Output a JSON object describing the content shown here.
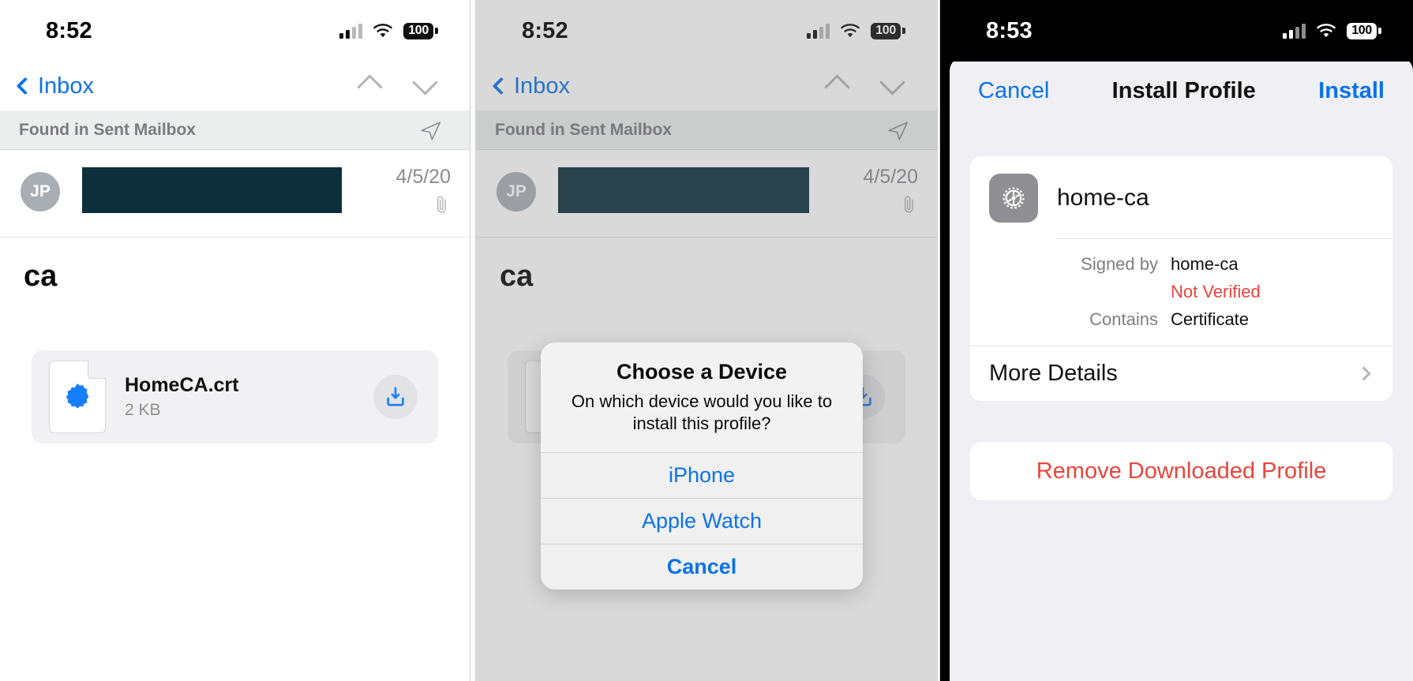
{
  "panels": [
    {
      "id": "mail-attachment",
      "status": {
        "time": "8:52",
        "battery": "100",
        "signal_icon": "cellular-signal-icon",
        "wifi_icon": "wifi-icon",
        "battery_icon": "battery-icon"
      },
      "nav": {
        "back_label": "Inbox",
        "up_icon": "chevron-up-icon",
        "down_icon": "chevron-down-icon",
        "back_icon": "chevron-left-icon"
      },
      "found_banner": {
        "text": "Found in Sent Mailbox",
        "icon": "send-arrow-icon"
      },
      "mail": {
        "avatar_initials": "JP",
        "date": "4/5/20",
        "attachment_icon": "paperclip-icon"
      },
      "subject": "ca",
      "attachment": {
        "filename": "HomeCA.crt",
        "filesize": "2 KB",
        "file_icon": "certificate-badge-icon",
        "download_icon": "download-icon"
      }
    },
    {
      "id": "choose-device",
      "status": {
        "time": "8:52",
        "battery": "100"
      },
      "nav": {
        "back_label": "Inbox"
      },
      "found_banner": {
        "text": "Found in Sent Mailbox"
      },
      "mail": {
        "avatar_initials": "JP",
        "date": "4/5/20"
      },
      "subject": "ca",
      "attachment": {
        "filename": "HomeCA.crt",
        "filesize": "2 KB"
      },
      "alert": {
        "title": "Choose a Device",
        "message": "On which device would you like to install this profile?",
        "buttons": [
          {
            "label": "iPhone",
            "style": "normal"
          },
          {
            "label": "Apple Watch",
            "style": "normal"
          },
          {
            "label": "Cancel",
            "style": "bold"
          }
        ]
      },
      "annotation": {
        "arrow_icon": "red-arrow-icon",
        "points_to": "iPhone"
      }
    },
    {
      "id": "install-profile",
      "status": {
        "time": "8:53",
        "battery": "100"
      },
      "sheet": {
        "cancel_label": "Cancel",
        "title": "Install Profile",
        "install_label": "Install",
        "profile": {
          "icon": "gear-icon",
          "name": "home-ca",
          "rows": [
            {
              "key": "Signed by",
              "value": "home-ca",
              "warn": "Not Verified"
            },
            {
              "key": "Contains",
              "value": "Certificate"
            }
          ],
          "more_details_label": "More Details",
          "more_details_icon": "chevron-right-icon"
        },
        "remove_label": "Remove Downloaded Profile"
      },
      "annotation": {
        "arrow_icon": "red-arrow-icon",
        "points_to": "Install"
      }
    }
  ],
  "colors": {
    "ios_blue": "#0a72e8",
    "ios_red": "#e8453c",
    "redaction": "#0d2f3c",
    "annotation_red": "#ee2222"
  }
}
